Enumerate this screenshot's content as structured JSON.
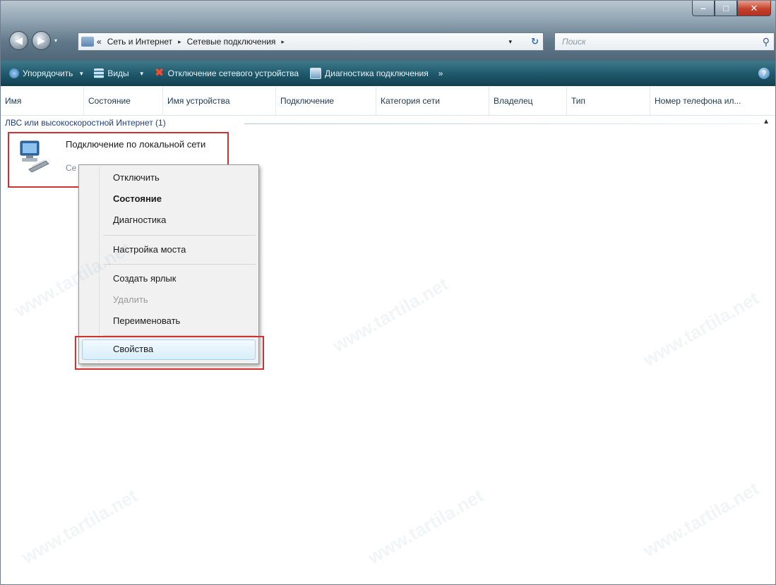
{
  "window": {
    "controls": {
      "minimize": "–",
      "maximize": "□",
      "close": "✕"
    }
  },
  "nav": {
    "back": "◀",
    "forward": "▶"
  },
  "address": {
    "overflow": "«",
    "crumbs": [
      "Сеть и Интернет",
      "Сетевые подключения"
    ],
    "separator": "▸",
    "dropdown": "▾",
    "refresh": "↻"
  },
  "search": {
    "placeholder": "Поиск",
    "icon": "search-icon"
  },
  "commandbar": {
    "organize": "Упорядочить",
    "views": "Виды",
    "disable_device": "Отключение сетевого устройства",
    "diagnose": "Диагностика подключения",
    "more": "»",
    "help": "?"
  },
  "columns": [
    "Имя",
    "Состояние",
    "Имя устройства",
    "Подключение",
    "Категория сети",
    "Владелец",
    "Тип",
    "Номер телефона ил..."
  ],
  "group": {
    "title": "ЛВС или высокоскоростной Интернет (1)",
    "collapse": "▲"
  },
  "item": {
    "name": "Подключение по локальной сети",
    "status": "Се"
  },
  "context_menu": {
    "items": [
      {
        "label": "Отключить",
        "state": "normal"
      },
      {
        "label": "Состояние",
        "state": "bold"
      },
      {
        "label": "Диагностика",
        "state": "normal"
      },
      {
        "label": "Настройка моста",
        "state": "normal"
      },
      {
        "label": "Создать ярлык",
        "state": "normal"
      },
      {
        "label": "Удалить",
        "state": "disabled"
      },
      {
        "label": "Переименовать",
        "state": "normal"
      },
      {
        "label": "Свойства",
        "state": "highlighted"
      }
    ]
  },
  "watermark": "www.tartila.net",
  "colors": {
    "highlight_border": "#d43030",
    "toolbar": "#1f5a6d",
    "link": "#1c3f8c"
  }
}
